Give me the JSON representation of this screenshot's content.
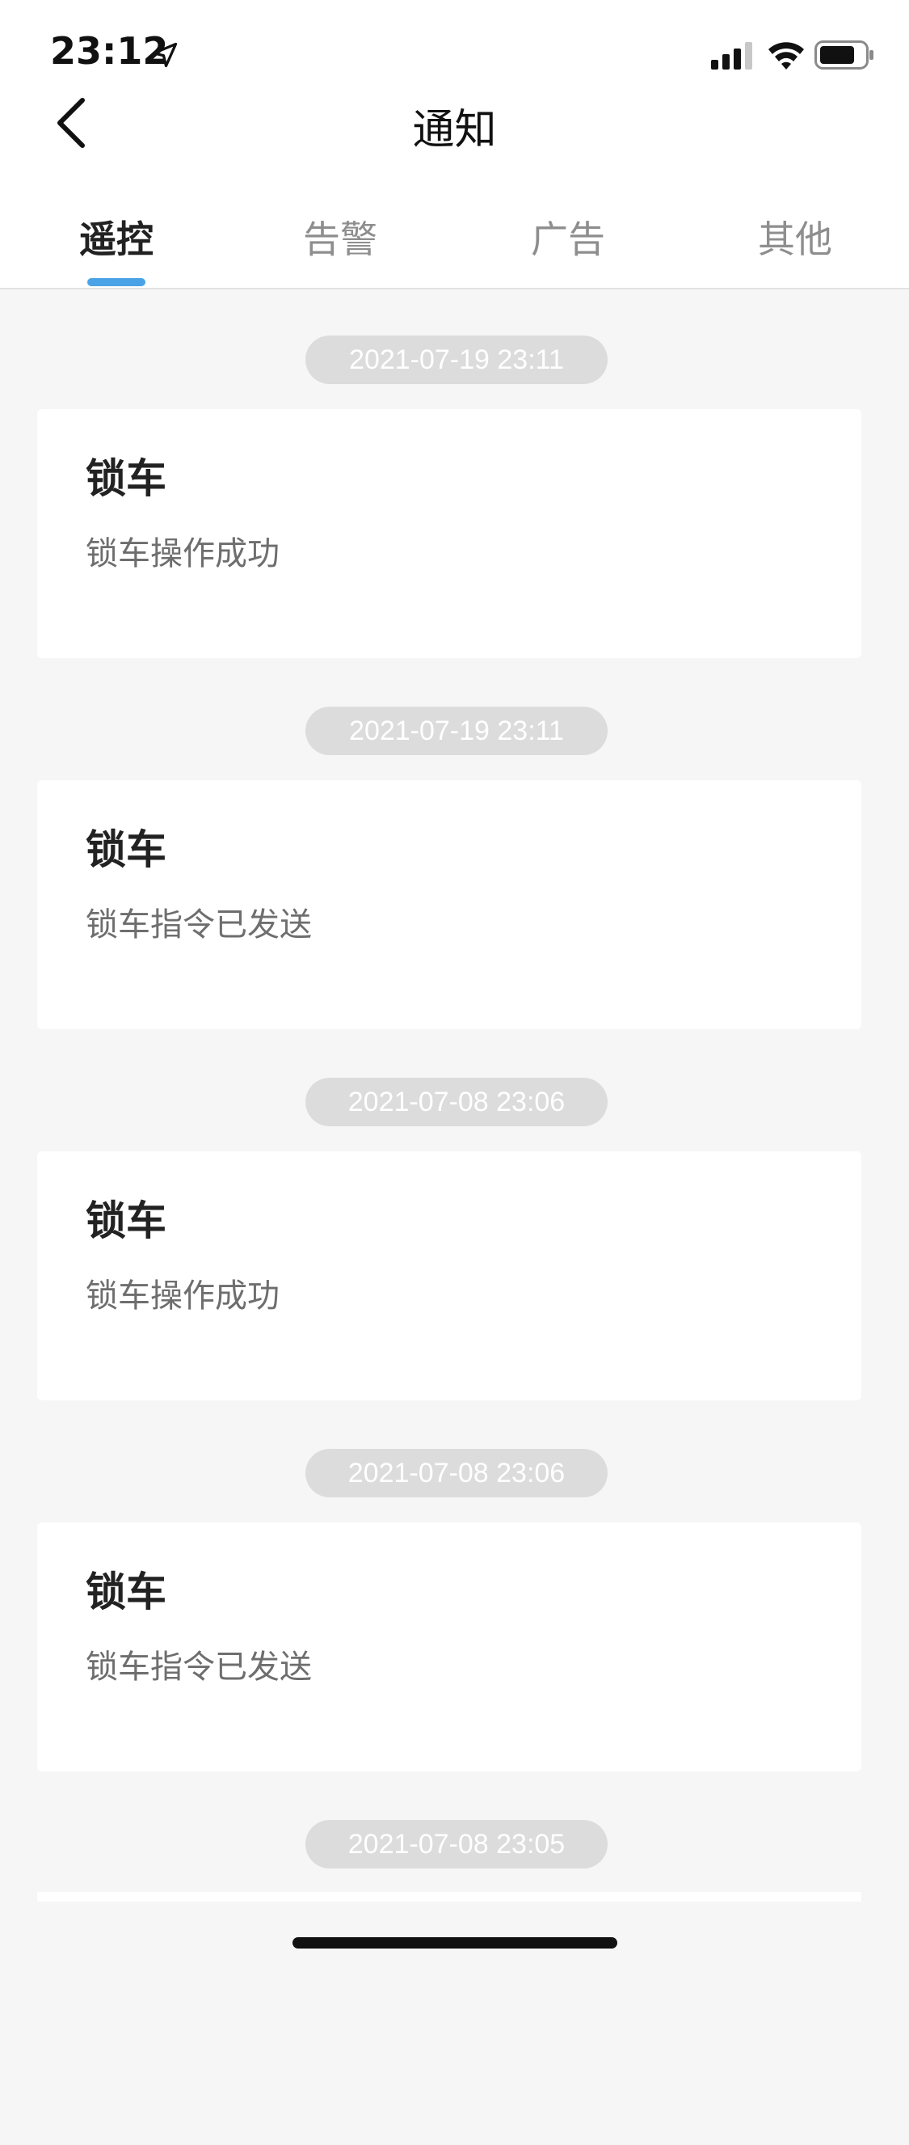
{
  "status_bar": {
    "time": "23:12",
    "icons": [
      "location-arrow-icon",
      "signal-icon",
      "wifi-icon",
      "battery-icon"
    ]
  },
  "nav": {
    "title": "通知",
    "back_icon": "chevron-left-icon"
  },
  "tabs": [
    {
      "label": "遥控",
      "active": true
    },
    {
      "label": "告警",
      "active": false
    },
    {
      "label": "广告",
      "active": false
    },
    {
      "label": "其他",
      "active": false
    }
  ],
  "notifications": [
    {
      "time": "2021-07-19 23:11",
      "title": "锁车",
      "body": "锁车操作成功"
    },
    {
      "time": "2021-07-19 23:11",
      "title": "锁车",
      "body": "锁车指令已发送"
    },
    {
      "time": "2021-07-08 23:06",
      "title": "锁车",
      "body": "锁车操作成功"
    },
    {
      "time": "2021-07-08 23:06",
      "title": "锁车",
      "body": "锁车指令已发送"
    },
    {
      "time": "2021-07-08 23:05"
    }
  ],
  "colors": {
    "accent": "#4aa3e6",
    "background": "#f6f6f6",
    "pill": "#dcdcdc",
    "inactive_tab": "#8e8e8e"
  }
}
